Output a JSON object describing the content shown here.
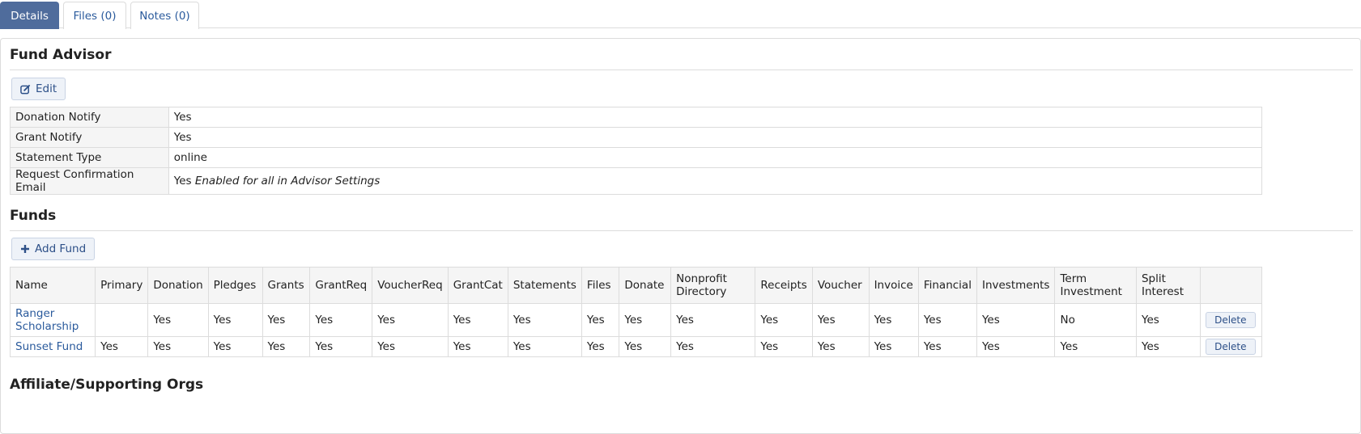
{
  "tabs": [
    {
      "label": "Details",
      "active": true
    },
    {
      "label": "Files (0)",
      "active": false
    },
    {
      "label": "Notes (0)",
      "active": false
    }
  ],
  "fund_advisor": {
    "title": "Fund Advisor",
    "edit_label": "Edit",
    "rows": [
      {
        "label": "Donation Notify",
        "value": "Yes",
        "note": ""
      },
      {
        "label": "Grant Notify",
        "value": "Yes",
        "note": ""
      },
      {
        "label": "Statement Type",
        "value": "online",
        "note": ""
      },
      {
        "label": "Request Confirmation Email",
        "value": "Yes",
        "note": "Enabled for all in Advisor Settings"
      }
    ]
  },
  "funds": {
    "title": "Funds",
    "add_label": "Add Fund",
    "delete_label": "Delete",
    "headers": [
      "Name",
      "Primary",
      "Donation",
      "Pledges",
      "Grants",
      "GrantReq",
      "VoucherReq",
      "GrantCat",
      "Statements",
      "Files",
      "Donate",
      "Nonprofit Directory",
      "Receipts",
      "Voucher",
      "Invoice",
      "Financial",
      "Investments",
      "Term Investment",
      "Split Interest",
      ""
    ],
    "rows": [
      [
        "Ranger Scholarship",
        "",
        "Yes",
        "Yes",
        "Yes",
        "Yes",
        "Yes",
        "Yes",
        "Yes",
        "Yes",
        "Yes",
        "Yes",
        "Yes",
        "Yes",
        "Yes",
        "Yes",
        "Yes",
        "No",
        "Yes"
      ],
      [
        "Sunset Fund",
        "Yes",
        "Yes",
        "Yes",
        "Yes",
        "Yes",
        "Yes",
        "Yes",
        "Yes",
        "Yes",
        "Yes",
        "Yes",
        "Yes",
        "Yes",
        "Yes",
        "Yes",
        "Yes",
        "Yes",
        "Yes"
      ]
    ]
  },
  "affiliate": {
    "title": "Affiliate/Supporting Orgs"
  },
  "icons": {
    "edit": "edit-icon",
    "add": "plus-icon"
  },
  "colors": {
    "tab_active": "#4f6c9c",
    "link": "#2a5a9c",
    "button_bg": "#eef2f8"
  }
}
